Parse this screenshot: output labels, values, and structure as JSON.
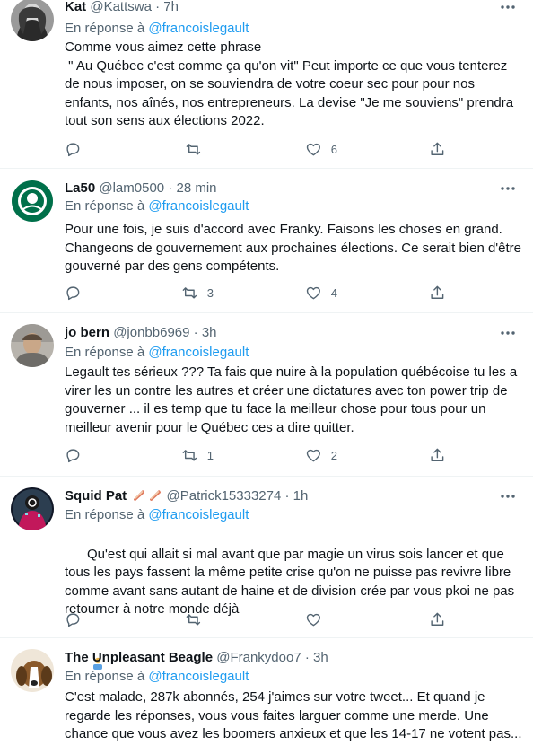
{
  "tweets": [
    {
      "name": "Kat",
      "handle": "@Kattswa",
      "time": "· 7h",
      "reply_prefix": "En réponse à",
      "reply_to": "@francoislegault",
      "text": "Comme vous aimez cette phrase\n \" Au Québec c'est comme ça qu'on vit\" Peut importe ce que vous tenterez de nous imposer, on se souviendra de votre coeur sec pour pour nos enfants, nos aînés, nos entrepreneurs. La devise \"Je me souviens\" prendra tout son sens aux élections 2022.",
      "replies": "",
      "retweets": "",
      "likes": "6"
    },
    {
      "name": "La50",
      "handle": "@lam0500",
      "time": "· 28 min",
      "reply_prefix": "En réponse à",
      "reply_to": "@francoislegault",
      "text": "Pour une fois, je suis d'accord avec Franky. Faisons les choses en grand. Changeons de gouvernement aux prochaines élections. Ce serait bien d'être gouverné par des gens compétents.",
      "replies": "",
      "retweets": "3",
      "likes": "4"
    },
    {
      "name": "jo bern",
      "handle": "@jonbb6969",
      "time": "· 3h",
      "reply_prefix": "En réponse à",
      "reply_to": "@francoislegault",
      "text": "Legault tes sérieux ??? Ta fais que nuire à la population québécoise tu les a virer les un contre les autres et créer une dictatures avec ton power trip de gouverner ... il es temp que tu face la meilleur chose pour tous pour un meilleur avenir pour le Québec ces a dire quitter.",
      "replies": "",
      "retweets": "1",
      "likes": "2"
    },
    {
      "name": "Squid Pat",
      "handle": "@Patrick15333274",
      "time": "· 1h",
      "reply_prefix": "En réponse à",
      "reply_to": "@francoislegault",
      "text": "Qu'est qui allait si mal avant que par magie un virus sois lancer et que tous les pays fassent la même petite crise qu'on ne puisse pas revivre libre comme avant sans autant de haine et de division crée par vous pkoi ne pas retourner à notre monde déjà",
      "replies": "",
      "retweets": "",
      "likes": ""
    },
    {
      "name": "The Unpleasant Beagle",
      "handle": "@Frankydoo7",
      "time": "· 3h",
      "reply_prefix": "En réponse à",
      "reply_to": "@francoislegault",
      "text": "C'est malade, 287k abonnés, 254 j'aimes sur votre tweet... Et quand je regarde les réponses, vous vous faites larguer comme une merde. Une chance que vous avez les boomers anxieux et que les 14-17 ne votent pas...",
      "replies": "",
      "retweets": "",
      "likes": ""
    }
  ],
  "icons": {
    "reply": "reply-icon",
    "retweet": "retweet-icon",
    "like": "heart-icon",
    "share": "share-icon",
    "more": "more-dots-icon",
    "badge": "bacon-emoji-icon",
    "person": "person-shrug-emoji-icon"
  },
  "colors": {
    "link": "#1d9bf0",
    "muted": "#536471",
    "divider": "#eff3f4"
  }
}
